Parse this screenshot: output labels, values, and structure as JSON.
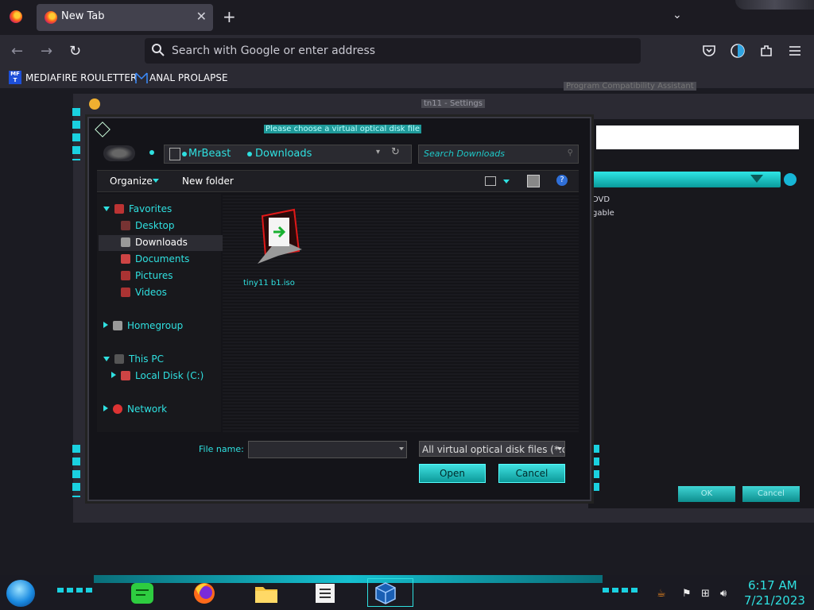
{
  "browser": {
    "tab_title": "New Tab",
    "tab_close": "✕",
    "new_tab": "+",
    "tab_list": "⌄",
    "back": "←",
    "forward": "→",
    "reload": "↻",
    "url_placeholder": "Search with Google or enter address",
    "bookmarks": [
      {
        "label": "MEDIAFIRE ROULETTER",
        "icon": "mediafire-icon",
        "icon_text": "MF\nT"
      },
      {
        "label": "ANAL PROLAPSE",
        "icon": "bookmark-flag-icon"
      }
    ]
  },
  "background_window": {
    "title": "tn11 - Settings",
    "inner_title": "Program Compatibility Assistant",
    "text_dvd": "DVD",
    "text_gable": "gable",
    "ok_label": "OK",
    "cancel_label": "Cancel"
  },
  "dialog": {
    "title": "Please choose a virtual optical disk file",
    "breadcrumb": [
      "MrBeast",
      "Downloads"
    ],
    "search_placeholder": "Search Downloads",
    "toolbar": {
      "organize": "Organize",
      "new_folder": "New folder",
      "help": "?"
    },
    "nav": {
      "favorites": "Favorites",
      "desktop": "Desktop",
      "downloads": "Downloads",
      "documents": "Documents",
      "pictures": "Pictures",
      "videos": "Videos",
      "homegroup": "Homegroup",
      "this_pc": "This PC",
      "local_disk": "Local Disk (C:)",
      "network": "Network"
    },
    "files": [
      {
        "name": "tiny11 b1.iso",
        "icon": "iso-file-icon"
      }
    ],
    "filename_label": "File name:",
    "filename_value": "",
    "filetype": "All virtual optical disk files (*.dn",
    "open_label": "Open",
    "cancel_label": "Cancel"
  },
  "taskbar": {
    "apps": [
      "sticky-notes-icon",
      "firefox-icon",
      "file-explorer-icon",
      "notes-icon",
      "virtualbox-icon"
    ],
    "time": "6:17 AM",
    "date": "7/21/2023"
  },
  "colors": {
    "accent": "#2fe0e0",
    "taskbar_glow": "#15c0d0",
    "tab_active": "#42414d"
  }
}
